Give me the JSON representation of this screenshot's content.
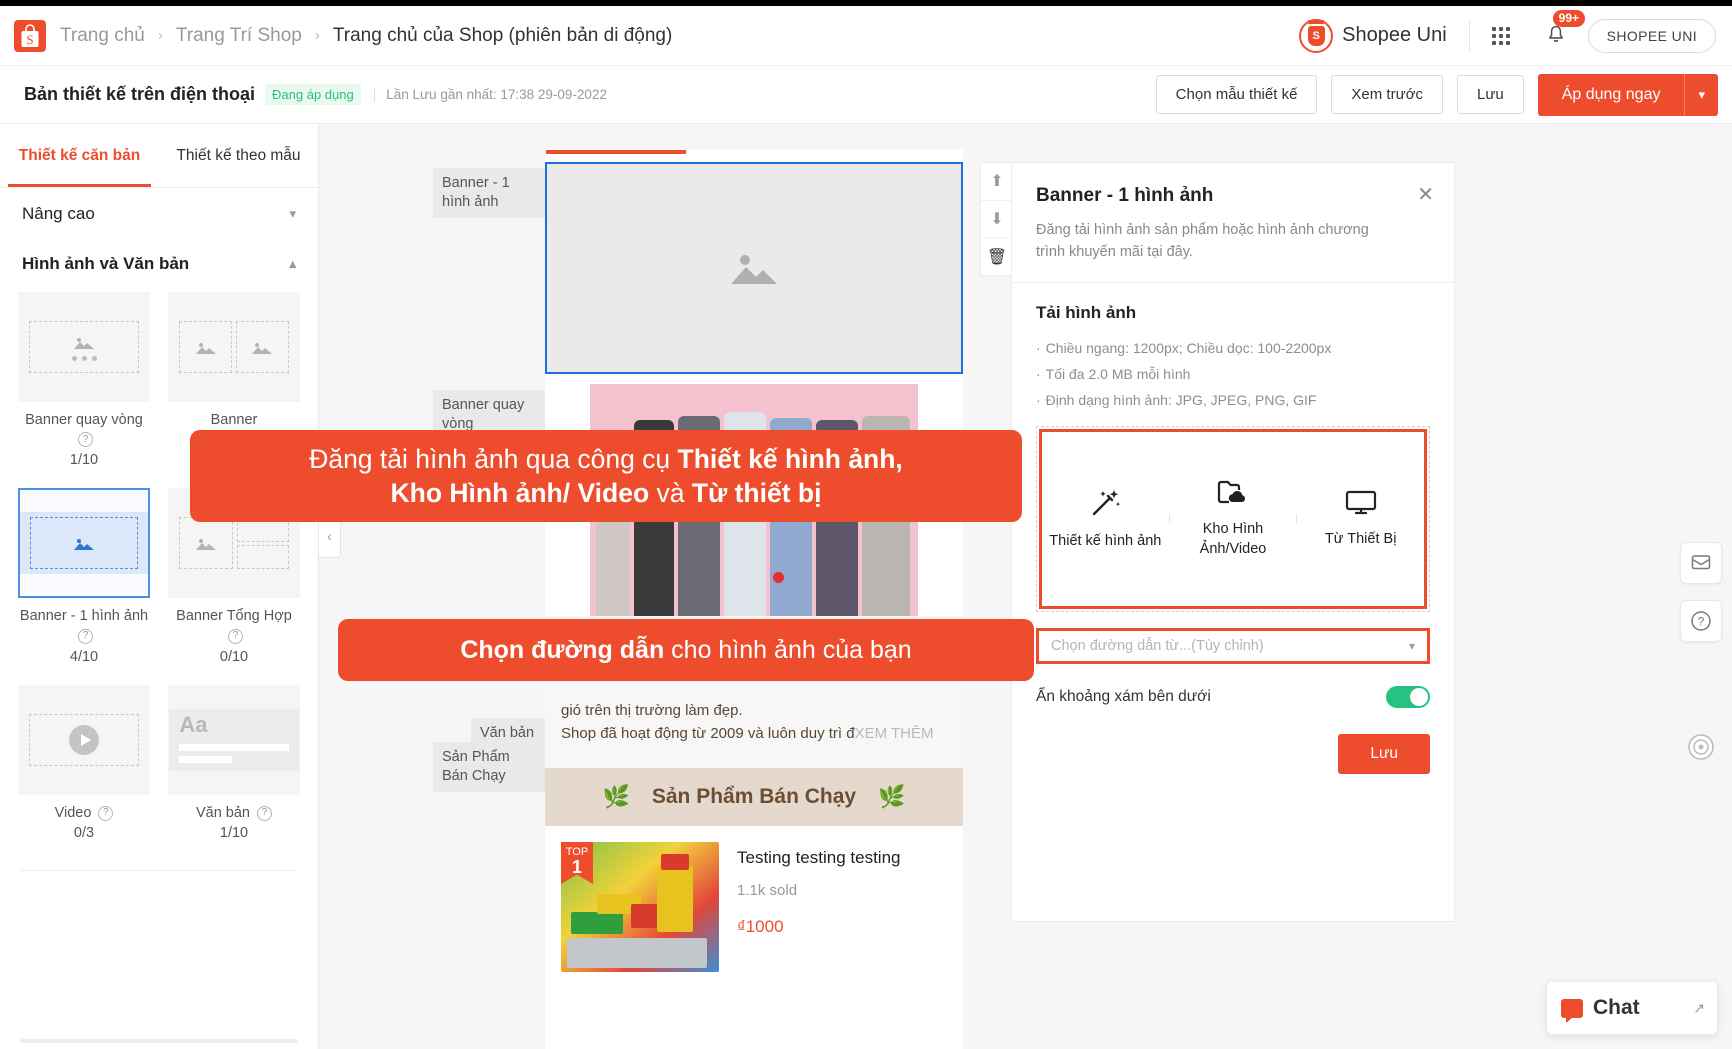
{
  "header": {
    "logo_icon": "shopee-bag-icon",
    "breadcrumbs": [
      {
        "label": "Trang chủ",
        "active": false
      },
      {
        "label": "Trang Trí Shop",
        "active": false
      },
      {
        "label": "Trang chủ của Shop (phiên bản di động)",
        "active": true
      }
    ],
    "separator": "›",
    "uni_brand": "Shopee Uni",
    "uni_seal_letter": "S",
    "apps_icon": "apps-grid-icon",
    "bell_icon": "bell-icon",
    "notification_badge": "99+",
    "account_pill": "SHOPEE UNI"
  },
  "toolbar": {
    "title": "Bản thiết kế trên điện thoại",
    "status_chip": "Đang áp dụng",
    "meta_divider": "|",
    "meta": "Lần Lưu gần nhất: 17:38 29-09-2022",
    "choose_template": "Chọn mẫu thiết kế",
    "preview": "Xem trước",
    "save": "Lưu",
    "apply_now": "Áp dụng ngay",
    "caret_icon": "chevron-down-icon"
  },
  "sidebar": {
    "tabs": [
      {
        "label": "Thiết kế căn bản",
        "active": true
      },
      {
        "label": "Thiết kế theo mẫu",
        "active": false
      }
    ],
    "sections": [
      {
        "label": "Nâng cao",
        "expanded": false,
        "chev": "chevron-down-icon"
      },
      {
        "label": "Hình ảnh và Văn bản",
        "expanded": true,
        "chev": "chevron-up-icon"
      }
    ],
    "widgets": [
      {
        "label": "Banner quay vòng",
        "count": "1/10",
        "help": "?",
        "kind": "carousel",
        "selected": false
      },
      {
        "label": "Banner",
        "count": "",
        "help": "?",
        "kind": "banner-pair",
        "selected": false
      },
      {
        "label": "Banner - 1 hình ảnh",
        "count": "4/10",
        "help": "?",
        "kind": "single-banner",
        "selected": true
      },
      {
        "label": "Banner Tổng Hợp",
        "count": "0/10",
        "help": "?",
        "kind": "combo-banner",
        "selected": false
      },
      {
        "label": "Video",
        "count": "0/3",
        "help": "?",
        "kind": "video",
        "selected": false
      },
      {
        "label": "Văn bản",
        "count": "1/10",
        "help": "?",
        "kind": "text",
        "selected": false
      }
    ]
  },
  "canvas": {
    "collapse_icon": "chevron-left-icon",
    "block_tags": [
      "Banner - 1 hình ảnh",
      "Banner quay vòng",
      "Văn bản",
      "Sản Phẩm Bán Chạy"
    ],
    "placeholder_icon": "image-placeholder-icon",
    "mover": {
      "up_icon": "arrow-up-icon",
      "down_icon": "arrow-down-icon",
      "delete_icon": "trash-icon"
    },
    "text_block": {
      "line1": "gió trên thị trường làm đẹp.",
      "line2": "Shop đã hoạt động từ 2009 và luôn duy trì đ",
      "more": "XEM THÊM"
    },
    "bestseller": {
      "title": "Sản Phẩm Bán Chạy",
      "leaf_icon": "laurel-icon",
      "ribbon_top": "TOP",
      "ribbon_rank": "1",
      "product_name": "Testing testing testing",
      "product_sold": "1.1k sold",
      "product_price": "₫1000"
    }
  },
  "properties": {
    "title": "Banner - 1 hình ảnh",
    "close_icon": "close-icon",
    "description": "Đăng tải hình ảnh sản phẩm hoặc hình ảnh chương trình khuyến mãi tại đây.",
    "upload_title": "Tải hình ảnh",
    "bullet_marker": "·",
    "bullets": [
      "Chiều ngang: 1200px; Chiều dọc: 100-2200px",
      "Tối đa 2.0 MB mỗi hình",
      "Định dạng hình ảnh: JPG, JPEG, PNG, GIF"
    ],
    "upload_options": [
      {
        "label": "Thiết kế hình ảnh",
        "icon": "magic-wand-icon"
      },
      {
        "label": "Kho Hình Ảnh/Video",
        "icon": "cloud-folder-icon"
      },
      {
        "label": "Từ Thiết Bị",
        "icon": "monitor-icon"
      }
    ],
    "path_placeholder": "Chọn đường dẫn từ...(Tùy chỉnh)",
    "path_caret_icon": "chevron-down-icon",
    "hide_gray_label": "Ẩn khoảng xám bên dưới",
    "hide_gray_on": true,
    "save_label": "Lưu"
  },
  "rail": {
    "feedback_icon": "feedback-envelope-icon",
    "help_icon": "question-circle-icon",
    "spiral_icon": "spiral-icon"
  },
  "chat": {
    "label": "Chat",
    "icon": "chat-bubble-icon",
    "expand_icon": "expand-icon"
  },
  "callouts": [
    {
      "id": "callout-upload-tools",
      "parts": [
        {
          "text": "Đăng tải hình ảnh qua công cụ ",
          "bold": false
        },
        {
          "text": "Thiết kế hình ảnh,",
          "bold": true
        },
        {
          "text": "\n",
          "bold": false
        },
        {
          "text": "Kho Hình ảnh/ Video",
          "bold": true
        },
        {
          "text": " và ",
          "bold": false
        },
        {
          "text": "Từ thiết bị",
          "bold": true
        }
      ],
      "plain": "Đăng tải hình ảnh qua công cụ Thiết kế hình ảnh, Kho Hình ảnh/ Video và Từ thiết bị"
    },
    {
      "id": "callout-choose-path",
      "parts": [
        {
          "text": "Chọn đường dẫn",
          "bold": true
        },
        {
          "text": " cho hình ảnh của bạn",
          "bold": false
        }
      ],
      "plain": "Chọn đường dẫn cho hình ảnh của bạn"
    }
  ],
  "colors": {
    "brand_orange": "#ee4d2d",
    "selected_blue": "#1f6fdd",
    "status_green": "#2bbd7e",
    "toggle_green": "#26c281"
  }
}
